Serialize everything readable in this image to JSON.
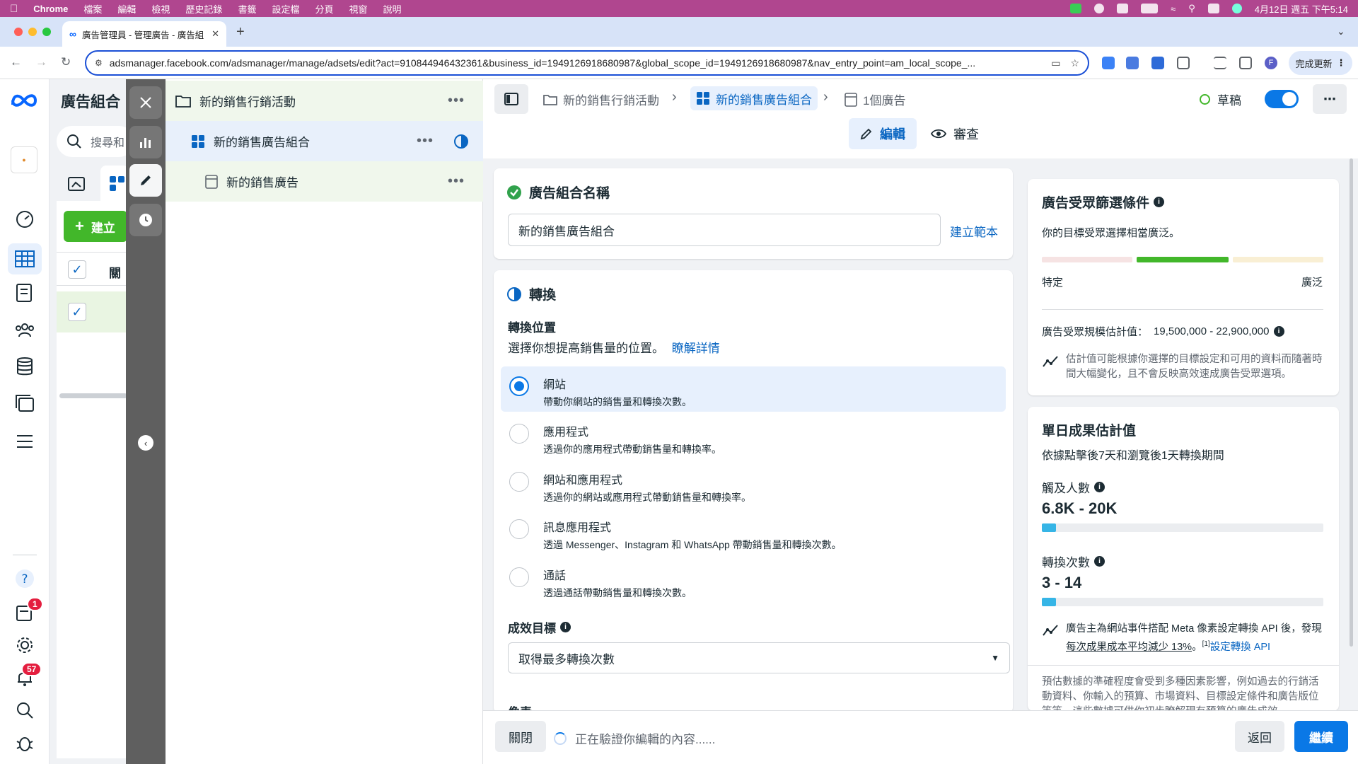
{
  "menubar": {
    "app": "Chrome",
    "items": [
      "檔案",
      "編輯",
      "檢視",
      "歷史記錄",
      "書籤",
      "設定檔",
      "分頁",
      "視窗",
      "說明"
    ],
    "clock": "4月12日 週五 下午5:14"
  },
  "browser": {
    "tab_title": "廣告管理員 - 管理廣告 - 廣告組",
    "url": "adsmanager.facebook.com/adsmanager/manage/adsets/edit?act=910844946432361&business_id=1949126918680987&global_scope_id=1949126918680987&nav_entry_point=am_local_scope_...",
    "update_label": "完成更新",
    "profile_initial": "F"
  },
  "leftnav": {
    "notif_badge_1": "1",
    "notif_badge_2": "57"
  },
  "listpanel": {
    "title": "廣告組合",
    "search_placeholder": "搜尋和",
    "create_label": "建立",
    "col_header": "關"
  },
  "tree": {
    "campaign": "新的銷售行銷活動",
    "adset": "新的銷售廣告組合",
    "ad": "新的銷售廣告",
    "more": "•••"
  },
  "breadcrumb": {
    "campaign": "新的銷售行銷活動",
    "adset": "新的銷售廣告組合",
    "ads": "1個廣告",
    "status": "草稿"
  },
  "mode_tabs": {
    "edit": "編輯",
    "review": "審查"
  },
  "adset_name_card": {
    "title": "廣告組合名稱",
    "value": "新的銷售廣告組合",
    "template_link": "建立範本"
  },
  "conversion_card": {
    "title": "轉換",
    "location_label": "轉換位置",
    "location_help": "選擇你想提高銷售量的位置。",
    "learn_more": "瞭解詳情",
    "options": [
      {
        "label": "網站",
        "desc": "帶動你網站的銷售量和轉換次數。",
        "selected": true
      },
      {
        "label": "應用程式",
        "desc": "透過你的應用程式帶動銷售量和轉換率。",
        "selected": false
      },
      {
        "label": "網站和應用程式",
        "desc": "透過你的網站或應用程式帶動銷售量和轉換率。",
        "selected": false
      },
      {
        "label": "訊息應用程式",
        "desc": "透過 Messenger、Instagram 和 WhatsApp 帶動銷售量和轉換次數。",
        "selected": false
      },
      {
        "label": "通話",
        "desc": "透過通話帶動銷售量和轉換次數。",
        "selected": false
      }
    ],
    "goal_label": "成效目標",
    "goal_value": "取得最多轉換次數",
    "next_section_partial": "像素"
  },
  "audience_card": {
    "title": "廣告受眾篩選條件",
    "summary": "你的目標受眾選擇相當廣泛。",
    "scale_left": "特定",
    "scale_right": "廣泛",
    "size_label": "廣告受眾規模估計值：",
    "size_value": "19,500,000 - 22,900,000",
    "note": "估計值可能根據你選擇的目標設定和可用的資料而隨著時間大幅變化，且不會反映高效速成廣告受眾選項。"
  },
  "results_card": {
    "title": "單日成果估計值",
    "subtitle": "依據點擊後7天和瀏覽後1天轉換期間",
    "reach_label": "觸及人數",
    "reach_value": "6.8K - 20K",
    "reach_fraction": 0.05,
    "conv_label": "轉換次數",
    "conv_value": "3 - 14",
    "conv_fraction": 0.05,
    "api_note_1": "廣告主為網站事件搭配 Meta 像素設定轉換 API 後，發現",
    "api_note_underlined": "每次成果成本平均減少 13%",
    "api_note_2": "。",
    "api_note_sup": "[1]",
    "api_link": "設定轉換 API",
    "disclaimer": "預估數據的準確程度會受到多種因素影響，例如過去的行銷活動資料、你輸入的預算、市場資料、目標設定條件和廣告版位等等。這些數據可供你初步瞭解現有預算的廣告成效，"
  },
  "bottombar": {
    "close": "關閉",
    "validating": "正在驗證你編輯的內容......",
    "back": "返回",
    "continue": "繼續"
  },
  "colors": {
    "menubar": "#b0468f",
    "primary": "#0a78e6",
    "green": "#42b72a",
    "estimate_bar": "#36b5e6"
  }
}
